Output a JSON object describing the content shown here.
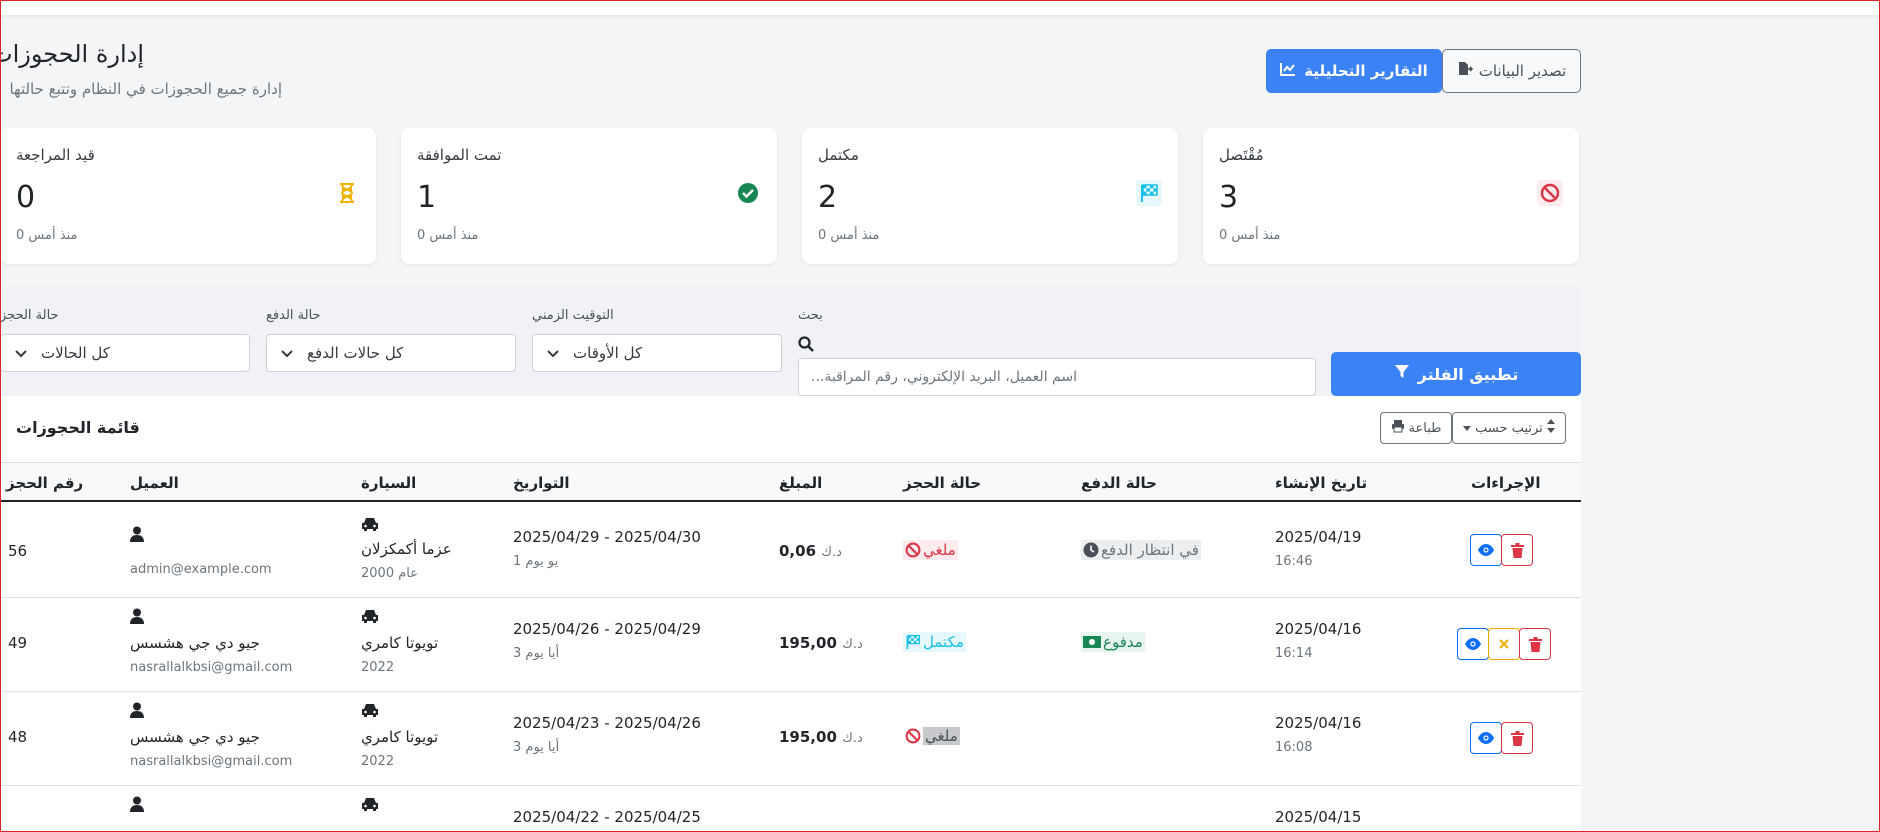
{
  "header": {
    "title": "إدارة الحجوزات",
    "subtitle": "إدارة جميع الحجوزات في النظام وتتبع حالتها",
    "analytics_label": "التقارير التحليلية",
    "export_label": "تصدير البيانات"
  },
  "cards": [
    {
      "label": "قيد المراجعة",
      "value": "0",
      "since": "منذ أمس 0",
      "icon": "hourglass-icon",
      "color": "#f0b400"
    },
    {
      "label": "تمت الموافقة",
      "value": "1",
      "since": "منذ أمس 0",
      "icon": "check-circle-icon",
      "color": "#198754"
    },
    {
      "label": "مكتمل",
      "value": "2",
      "since": "منذ أمس 0",
      "icon": "checkered-flag-icon",
      "color": "#17c1e8"
    },
    {
      "label": "مُقْتَصل",
      "value": "3",
      "since": "منذ أمس 0",
      "icon": "ban-icon",
      "color": "#dc3545"
    }
  ],
  "filters": {
    "booking_status_label": "حالة الحجز",
    "booking_status_value": "كل الحالات",
    "payment_status_label": "حالة الدفع",
    "payment_status_value": "كل حالات الدفع",
    "timing_label": "التوقيت الزمني",
    "timing_value": "كل الأوقات",
    "search_label": "بحث",
    "search_placeholder": "...اسم العميل، البريد الإلكتروني، رقم المراقبة",
    "apply_label": "تطبيق الفلتر"
  },
  "table": {
    "title": "قائمة الحجوزات",
    "print_label": "طباعة",
    "sort_label": "ترتيب حسب",
    "headers": {
      "booking_no": "رقم الحجز",
      "customer": "العميل",
      "car": "السيارة",
      "dates": "التواريخ",
      "amount": "المبلغ",
      "booking_status": "حالة الحجز",
      "payment_status": "حالة الدفع",
      "created": "تاريخ الإنشاء",
      "actions": "الإجراءات"
    },
    "rows": [
      {
        "id": "56",
        "customer_name": "",
        "email": "admin@example.com",
        "car": "عزما أكمكزلان",
        "car_year": "عام 2000",
        "dates": "2025/04/29 - 2025/04/30",
        "duration": "يو يوم 1",
        "amount": "0,06",
        "currency": "د.ك",
        "booking_status": "ملغي",
        "payment_status": "في انتظار الدفع",
        "created_date": "2025/04/19",
        "created_time": "16:46"
      },
      {
        "id": "49",
        "customer_name": "جيو دي جي هشسس",
        "email": "nasrallalkbsi@gmail.com",
        "car": "تويوتا كامري",
        "car_year": "2022",
        "dates": "2025/04/26 - 2025/04/29",
        "duration": "أيا يوم 3",
        "amount": "195,00",
        "currency": "د.ك",
        "booking_status": "مكتمل",
        "payment_status": "مدفوع",
        "created_date": "2025/04/16",
        "created_time": "16:14"
      },
      {
        "id": "48",
        "customer_name": "جيو دي جي هشسس",
        "email": "nasrallalkbsi@gmail.com",
        "car": "تويوتا كامري",
        "car_year": "2022",
        "dates": "2025/04/23 - 2025/04/26",
        "duration": "أيا يوم 3",
        "amount": "195,00",
        "currency": "د.ك",
        "booking_status": "ملغي",
        "payment_status": "",
        "created_date": "2025/04/16",
        "created_time": "16:08"
      },
      {
        "id": "",
        "customer_name": "",
        "email": "",
        "car": "",
        "car_year": "",
        "dates": "2025/04/22 - 2025/04/25",
        "duration": "",
        "amount": "",
        "currency": "",
        "booking_status": "",
        "payment_status": "",
        "created_date": "2025/04/15",
        "created_time": ""
      }
    ]
  }
}
